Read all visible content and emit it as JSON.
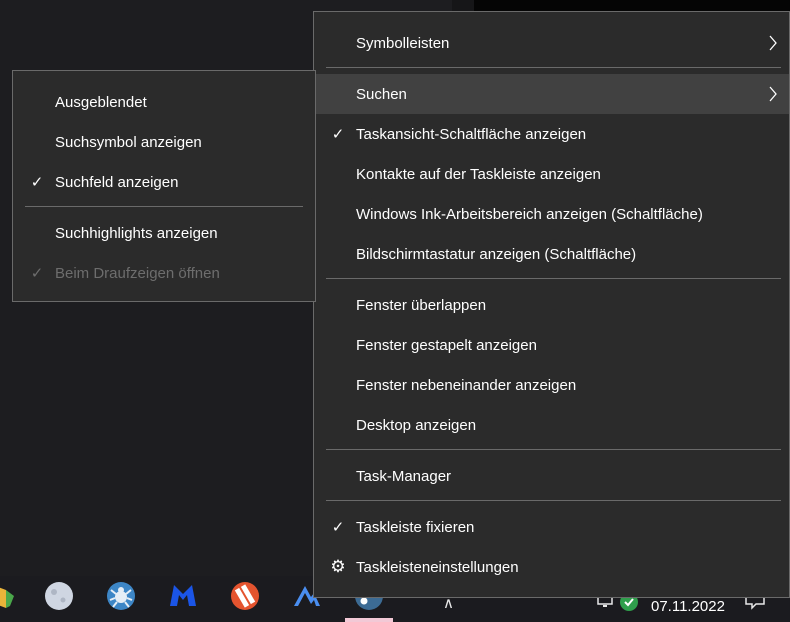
{
  "context_menu": {
    "items": [
      {
        "label": "Symbolleisten",
        "has_submenu": true
      },
      {
        "label": "Suchen",
        "has_submenu": true,
        "highlighted": true
      },
      {
        "label": "Taskansicht-Schaltfläche anzeigen",
        "checked": true
      },
      {
        "label": "Kontakte auf der Taskleiste anzeigen"
      },
      {
        "label": "Windows Ink-Arbeitsbereich anzeigen (Schaltfläche)"
      },
      {
        "label": "Bildschirmtastatur anzeigen (Schaltfläche)"
      },
      {
        "label": "Fenster überlappen"
      },
      {
        "label": "Fenster gestapelt anzeigen"
      },
      {
        "label": "Fenster nebeneinander anzeigen"
      },
      {
        "label": "Desktop anzeigen"
      },
      {
        "label": "Task-Manager"
      },
      {
        "label": "Taskleiste fixieren",
        "checked": true
      },
      {
        "label": "Taskleisteneinstellungen",
        "icon": "gear-icon"
      }
    ]
  },
  "search_submenu": {
    "items": [
      {
        "label": "Ausgeblendet"
      },
      {
        "label": "Suchsymbol anzeigen"
      },
      {
        "label": "Suchfeld anzeigen",
        "checked": true
      },
      {
        "label": "Suchhighlights anzeigen"
      },
      {
        "label": "Beim Draufzeigen öffnen",
        "checked": true,
        "disabled": true
      }
    ]
  },
  "glyphs": {
    "check": "✓",
    "gear": "⚙",
    "tray_chevron": "∧"
  },
  "taskbar": {
    "date": "07.11.2022",
    "icons": [
      "folder-app-icon",
      "moon-app-icon",
      "spider-app-icon",
      "malwarebytes-icon",
      "sync-app-icon",
      "nordvpn-icon",
      "steam-icon"
    ]
  },
  "colors": {
    "menu_bg": "#2b2b2b",
    "highlight": "#414141",
    "separator": "#6a6a6a",
    "disabled_text": "#6d6d6d"
  }
}
